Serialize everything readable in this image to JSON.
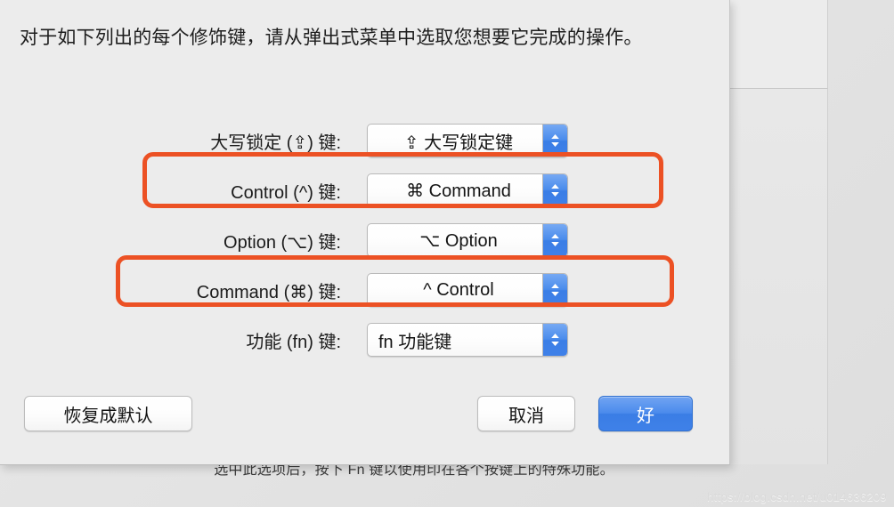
{
  "sheet": {
    "description": "对于如下列出的每个修饰键，请从弹出式菜单中选取您想要它完成的操作。",
    "rows": [
      {
        "label": "大写锁定 (⇪) 键:",
        "value": "⇪ 大写锁定键",
        "align": "center"
      },
      {
        "label": "Control (^) 键:",
        "value": "⌘ Command",
        "align": "center"
      },
      {
        "label": "Option (⌥) 键:",
        "value": "⌥ Option",
        "align": "center"
      },
      {
        "label": "Command (⌘) 键:",
        "value": "^ Control",
        "align": "center"
      },
      {
        "label": "功能 (fn) 键:",
        "value": "fn 功能键",
        "align": "left"
      }
    ],
    "buttons": {
      "restore_defaults": "恢复成默认",
      "cancel": "取消",
      "ok": "好"
    }
  },
  "background": {
    "hint": "选中此选项后，按下 Fn 键以使用印在各个按键上的特殊功能。",
    "watermark": "https://blog.csdn.net/u014636209"
  },
  "annotations": [
    {
      "name": "control-row-highlight",
      "color": "#ec5124"
    },
    {
      "name": "command-row-highlight",
      "color": "#ec5124"
    }
  ],
  "colors": {
    "accent_blue": "#3f81e8",
    "annotation_orange": "#ec5124",
    "sheet_background": "#ececec"
  }
}
